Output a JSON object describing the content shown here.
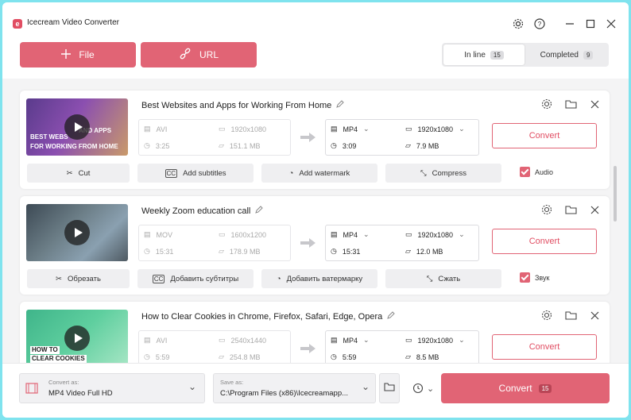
{
  "app": {
    "title": "Icecream Video Converter",
    "logo_letter": "e"
  },
  "toolbar": {
    "file_label": "File",
    "url_label": "URL",
    "tab_inline": "In line",
    "inline_count": "15",
    "tab_completed": "Completed",
    "completed_count": "9"
  },
  "colors": {
    "accent": "#e16475",
    "accent_text": "#e14d62",
    "background": "#f4f4f5"
  },
  "videos": [
    {
      "title": "Best Websites and Apps for Working From Home",
      "thumb_text": [
        "BEST WEBS",
        "AND APPS",
        "FOR WORKING FROM HOME"
      ],
      "src": {
        "format": "AVI",
        "resolution": "1920x1080",
        "duration": "3:25",
        "size": "151.1 MB"
      },
      "dst": {
        "format": "MP4",
        "resolution": "1920x1080",
        "duration": "3:09",
        "size": "7.9 MB"
      },
      "convert_label": "Convert",
      "actions": {
        "cut": "Cut",
        "subtitles": "Add subtitles",
        "watermark": "Add watermark",
        "compress": "Compress",
        "audio": "Audio"
      }
    },
    {
      "title": "Weekly Zoom education call",
      "thumb_text": [],
      "src": {
        "format": "MOV",
        "resolution": "1600x1200",
        "duration": "15:31",
        "size": "178.9 MB"
      },
      "dst": {
        "format": "MP4",
        "resolution": "1920x1080",
        "duration": "15:31",
        "size": "12.0 MB"
      },
      "convert_label": "Convert",
      "actions": {
        "cut": "Обрезать",
        "subtitles": "Добавить субтитры",
        "watermark": "Добавить ватермарку",
        "compress": "Сжать",
        "audio": "Звук"
      }
    },
    {
      "title": "How to Clear Cookies in Chrome, Firefox, Safari, Edge, Opera",
      "thumb_text": [
        "HOW TO",
        "CLEAR COOKIES"
      ],
      "src": {
        "format": "AVI",
        "resolution": "2540x1440",
        "duration": "5:59",
        "size": "254.8 MB"
      },
      "dst": {
        "format": "MP4",
        "resolution": "1920x1080",
        "duration": "5:59",
        "size": "8.5 MB"
      },
      "convert_label": "Convert"
    }
  ],
  "bottom": {
    "convert_as_label": "Convert as:",
    "convert_as_value": "MP4 Video Full HD",
    "save_as_label": "Save as:",
    "save_as_value": "C:\\Program Files (x86)\\Icecreamapp...",
    "convert_all_label": "Convert",
    "convert_all_count": "15"
  }
}
